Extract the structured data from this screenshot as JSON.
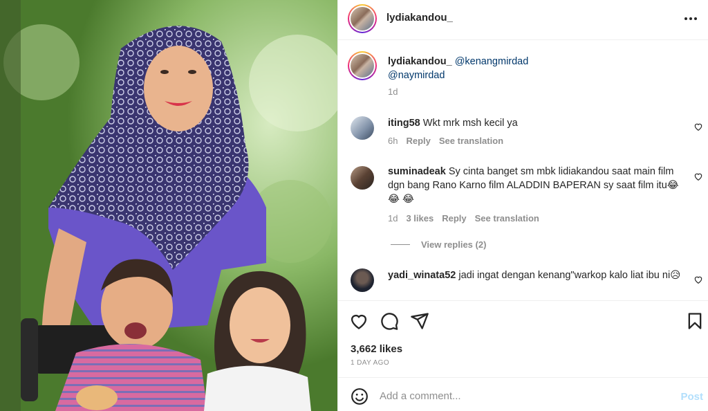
{
  "post": {
    "username": "lydiakandou_",
    "more_label": "More options"
  },
  "caption": {
    "username": "lydiakandou_",
    "mention1": "@kenangmirdad",
    "mention2": "@naymirdad",
    "time": "1d"
  },
  "comments": [
    {
      "username": "iting58",
      "text": "Wkt mrk msh kecil ya",
      "time": "6h",
      "likes": "",
      "reply": "Reply",
      "translate": "See translation"
    },
    {
      "username": "suminadeak",
      "text": "Sy cinta banget sm mbk lidiakandou saat main film dgn bang Rano Karno film ALADDIN BAPERAN sy saat film itu😂 😂 😂",
      "time": "1d",
      "likes": "3 likes",
      "reply": "Reply",
      "translate": "See translation",
      "view_replies": "View replies (2)"
    },
    {
      "username": "yadi_winata52",
      "text": "jadi ingat dengan kenang\"warkop kalo liat ibu ni😥"
    }
  ],
  "likes": "3,662 likes",
  "date": "1 DAY AGO",
  "add_comment": {
    "placeholder": "Add a comment...",
    "post_label": "Post"
  },
  "icons": {
    "like": "heart-icon",
    "comment": "comment-icon",
    "share": "share-icon",
    "save": "bookmark-icon",
    "emoji": "emoji-icon",
    "more": "more-icon"
  },
  "colors": {
    "text": "#262626",
    "muted": "#8e8e8e",
    "link": "#00376b",
    "post_button": "#b2dffc",
    "border": "#efefef"
  }
}
